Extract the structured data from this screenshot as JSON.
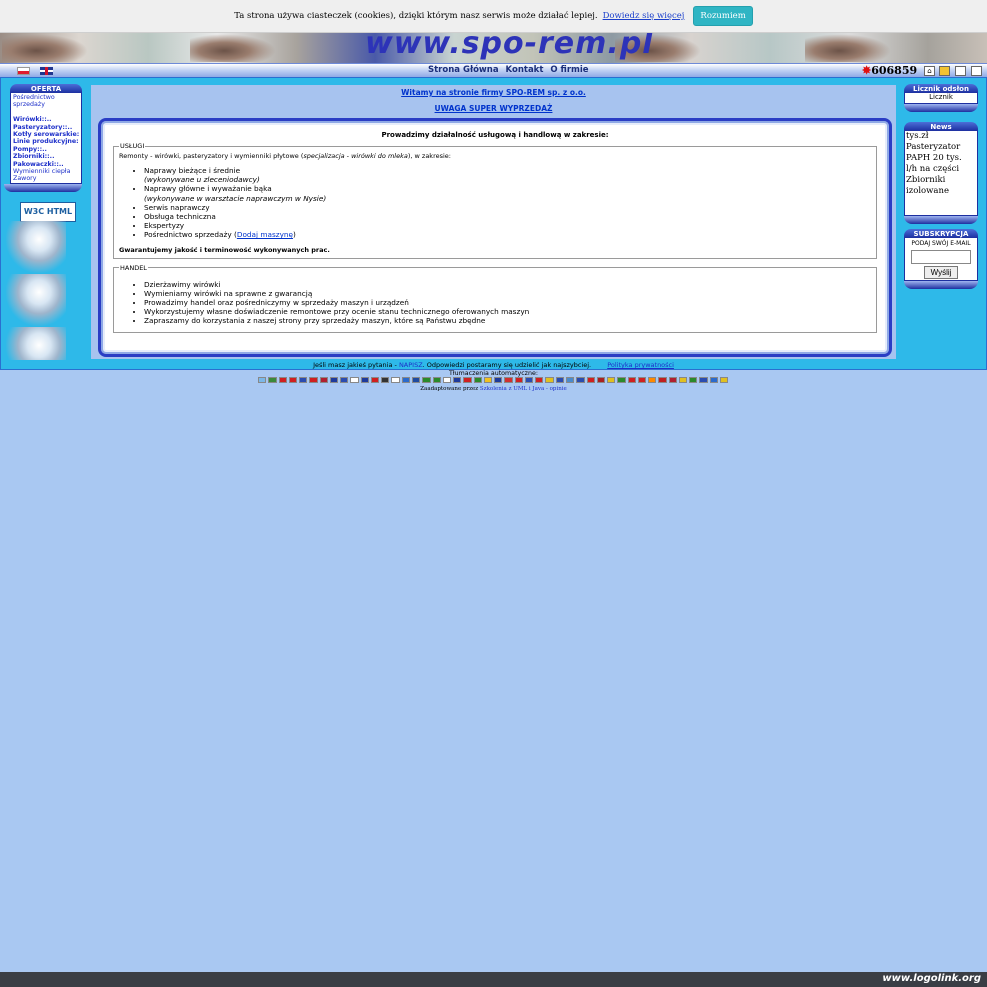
{
  "cookie": {
    "text": "Ta strona używa ciasteczek (cookies), dzięki którym nasz serwis może działać lepiej.",
    "more_link": "Dowiedz się więcej",
    "accept": "Rozumiem"
  },
  "header": {
    "logo_text": "www.spo-rem.pl"
  },
  "nav": {
    "links": [
      "Strona Główna",
      "Kontakt",
      "O firmie"
    ],
    "counter": "606859"
  },
  "left": {
    "offer_title": "OFERTA",
    "items": [
      {
        "label": "Pośrednictwo",
        "bold": false
      },
      {
        "label": "sprzedaży",
        "bold": false
      },
      {
        "label": "",
        "bold": false
      },
      {
        "label": "Wirówki::..",
        "bold": true
      },
      {
        "label": "Pasteryzatory::..",
        "bold": true
      },
      {
        "label": "Kotły serowarskie::..",
        "bold": true
      },
      {
        "label": "Linie produkcyjne::..",
        "bold": true
      },
      {
        "label": "Pompy::..",
        "bold": true
      },
      {
        "label": "Zbiorniki::..",
        "bold": true
      },
      {
        "label": "Pakowaczki::..",
        "bold": true
      },
      {
        "label": "Wymienniki ciepła",
        "bold": false
      },
      {
        "label": "Zawory",
        "bold": false
      }
    ],
    "w3c_label": "W3C HTML 4.01"
  },
  "content": {
    "welcome": "Witamy na stronie firmy SPO-REM sp. z o.o.",
    "sale": "UWAGA SUPER WYPRZEDAŻ",
    "panel_title": "Prowadzimy działalność usługową i handlową w zakresie:",
    "services_legend": "USŁUGI",
    "services_intro": "Remonty - wirówki, pasteryzatory i wymienniki płytowe (",
    "services_intro_em": "specjalizacja - wirówki do mleka",
    "services_intro_end": "), w zakresie:",
    "services": [
      {
        "text": "Naprawy bieżące i średnie",
        "sub": "(wykonywane u zleceniodawcy)"
      },
      {
        "text": "Naprawy główne i wyważanie bąka",
        "sub": "(wykonywane w warsztacie naprawczym w Nysie)"
      },
      {
        "text": "Serwis naprawczy",
        "sub": ""
      },
      {
        "text": "Obsługa techniczna",
        "sub": ""
      },
      {
        "text": "Ekspertyzy",
        "sub": ""
      }
    ],
    "brokerage_text": "Pośrednictwo sprzedaży (",
    "brokerage_link": "Dodaj maszynę",
    "brokerage_end": ")",
    "guarantee": "Gwarantujemy jakość i terminowość wykonywanych prac.",
    "trade_legend": "HANDEL",
    "trade": [
      "Dzierżawimy wirówki",
      "Wymieniamy wirówki na sprawne z gwarancją",
      "Prowadzimy handel oraz pośredniczymy w sprzedaży maszyn i urządzeń",
      "Wykorzystujemy własne doświadczenie remontowe przy ocenie stanu technicznego oferowanych maszyn",
      "Zapraszamy do korzystania z naszej strony przy sprzedaży maszyn, które są Państwu zbędne"
    ]
  },
  "right": {
    "counter_title": "Licznik odsłon",
    "counter_img_alt": "Licznik",
    "news_title": "News",
    "news_lines": [
      "tys.zł",
      "Pasteryzator",
      "PAPH 20 tys.",
      "l/h na części",
      "Zbiorniki",
      "izolowane"
    ],
    "subscribe_title": "SUBSKRYPCJA",
    "subscribe_label": "PODAJ SWÓJ E-MAIL",
    "email_placeholder": "",
    "subscribe_button": "Wyślij"
  },
  "footer": {
    "question_prefix": "Jeśli masz jakieś pytania - ",
    "question_link": "NAPISZ",
    "question_suffix": ". Odpowiedzi postaramy się udzielić jak najszybciej.",
    "privacy_link": "Polityka prywatności",
    "translations_label": "Tłumaczenia automatyczne:",
    "powered_prefix": "Zaadaptowane przez ",
    "powered_link": "Szkolenia z UML i Java - opinie",
    "logolink": "www.logolink.org"
  },
  "colors": {
    "page_bg": "#a9c8f2",
    "frame_bg": "#2eb9e9",
    "accent_blue": "#1d2fa0",
    "cookie_button": "#2fb5c4"
  }
}
